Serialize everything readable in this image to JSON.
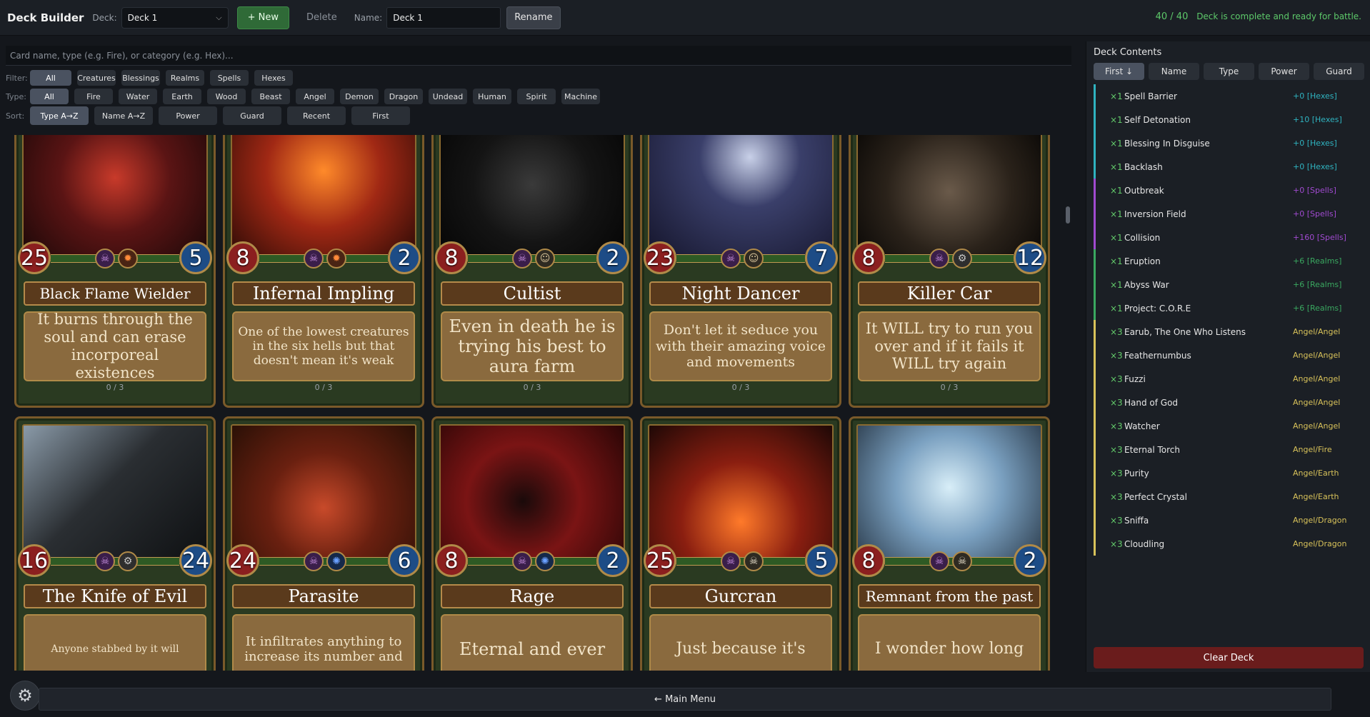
{
  "header": {
    "title": "Deck Builder",
    "deck_label": "Deck:",
    "deck_value": "Deck 1",
    "new_label": "+ New",
    "delete_label": "Delete",
    "name_label": "Name:",
    "name_value": "Deck 1",
    "rename_label": "Rename",
    "count": "40 / 40",
    "status": "Deck is complete and ready for battle."
  },
  "search": {
    "placeholder": "Card name, type (e.g. Fire), or category (e.g. Hex)..."
  },
  "filters": {
    "filter_label": "Filter:",
    "filter": [
      "All",
      "Creatures",
      "Blessings",
      "Realms",
      "Spells",
      "Hexes"
    ],
    "type_label": "Type:",
    "types": [
      "All",
      "Fire",
      "Water",
      "Earth",
      "Wood",
      "Beast",
      "Angel",
      "Demon",
      "Dragon",
      "Undead",
      "Human",
      "Spirit",
      "Machine"
    ],
    "sort_label": "Sort:",
    "sorts": [
      "Type A→Z",
      "Name A→Z",
      "Power",
      "Guard",
      "Recent",
      "First"
    ]
  },
  "cards": [
    {
      "name": "Black Flame Wielder",
      "power": "25",
      "guard": "5",
      "text": "It burns through the soul and can erase incorporeal existences",
      "owned": "0 / 3",
      "icons": [
        "demon-icon",
        "fire-icon"
      ]
    },
    {
      "name": "Infernal Impling",
      "power": "8",
      "guard": "2",
      "text": "One of the lowest creatures in the six hells but that doesn't mean it's weak",
      "owned": "0 / 3",
      "icons": [
        "demon-icon",
        "fire-icon"
      ]
    },
    {
      "name": "Cultist",
      "power": "8",
      "guard": "2",
      "text": "Even in death he is trying his best to aura farm",
      "owned": "0 / 3",
      "icons": [
        "demon-icon",
        "human-icon"
      ]
    },
    {
      "name": "Night Dancer",
      "power": "23",
      "guard": "7",
      "text": "Don't let it seduce you with their amazing voice and movements",
      "owned": "0 / 3",
      "icons": [
        "demon-icon",
        "human-icon"
      ]
    },
    {
      "name": "Killer Car",
      "power": "8",
      "guard": "12",
      "text": "It WILL try to run you over and if it fails it WILL try again",
      "owned": "0 / 3",
      "icons": [
        "demon-icon",
        "machine-icon"
      ]
    },
    {
      "name": "The Knife of Evil",
      "power": "16",
      "guard": "24",
      "text": "Anyone stabbed by it will",
      "owned": "",
      "icons": [
        "demon-icon",
        "machine-icon"
      ]
    },
    {
      "name": "Parasite",
      "power": "24",
      "guard": "6",
      "text": "It infiltrates anything to increase its number and",
      "owned": "",
      "icons": [
        "demon-icon",
        "spirit-icon"
      ]
    },
    {
      "name": "Rage",
      "power": "8",
      "guard": "2",
      "text": "Eternal and ever",
      "owned": "",
      "icons": [
        "demon-icon",
        "spirit-icon"
      ]
    },
    {
      "name": "Gurcran",
      "power": "25",
      "guard": "5",
      "text": "Just because it's",
      "owned": "",
      "icons": [
        "demon-icon",
        "undead-icon"
      ]
    },
    {
      "name": "Remnant from the past",
      "power": "8",
      "guard": "2",
      "text": "I wonder how long",
      "owned": "",
      "icons": [
        "demon-icon",
        "undead-icon"
      ]
    }
  ],
  "deck": {
    "title": "Deck Contents",
    "sort_tabs": [
      "First ↓",
      "Name",
      "Type",
      "Power",
      "Guard"
    ],
    "items": [
      {
        "qty": "×1",
        "name": "Spell Barrier",
        "meta": "+0 [Hexes]",
        "color": "#2fb3c0"
      },
      {
        "qty": "×1",
        "name": "Self Detonation",
        "meta": "+10 [Hexes]",
        "color": "#2fb3c0"
      },
      {
        "qty": "×1",
        "name": "Blessing In Disguise",
        "meta": "+0 [Hexes]",
        "color": "#2fb3c0"
      },
      {
        "qty": "×1",
        "name": "Backlash",
        "meta": "+0 [Hexes]",
        "color": "#2fb3c0"
      },
      {
        "qty": "×1",
        "name": "Outbreak",
        "meta": "+0 [Spells]",
        "color": "#a04ad0"
      },
      {
        "qty": "×1",
        "name": "Inversion Field",
        "meta": "+0 [Spells]",
        "color": "#a04ad0"
      },
      {
        "qty": "×1",
        "name": "Collision",
        "meta": "+160 [Spells]",
        "color": "#a04ad0"
      },
      {
        "qty": "×1",
        "name": "Eruption",
        "meta": "+6 [Realms]",
        "color": "#3aa860"
      },
      {
        "qty": "×1",
        "name": "Abyss War",
        "meta": "+6 [Realms]",
        "color": "#3aa860"
      },
      {
        "qty": "×1",
        "name": "Project: C.O.R.E",
        "meta": "+6 [Realms]",
        "color": "#3aa860"
      },
      {
        "qty": "×3",
        "name": "Earub, The One Who Listens",
        "meta": "Angel/Angel",
        "color": "#d8c25a"
      },
      {
        "qty": "×3",
        "name": "Feathernumbus",
        "meta": "Angel/Angel",
        "color": "#d8c25a"
      },
      {
        "qty": "×3",
        "name": "Fuzzi",
        "meta": "Angel/Angel",
        "color": "#d8c25a"
      },
      {
        "qty": "×3",
        "name": "Hand of God",
        "meta": "Angel/Angel",
        "color": "#d8c25a"
      },
      {
        "qty": "×3",
        "name": "Watcher",
        "meta": "Angel/Angel",
        "color": "#d8c25a"
      },
      {
        "qty": "×3",
        "name": "Eternal Torch",
        "meta": "Angel/Fire",
        "color": "#d8c25a"
      },
      {
        "qty": "×3",
        "name": "Purity",
        "meta": "Angel/Earth",
        "color": "#d8c25a"
      },
      {
        "qty": "×3",
        "name": "Perfect Crystal",
        "meta": "Angel/Earth",
        "color": "#d8c25a"
      },
      {
        "qty": "×3",
        "name": "Sniffa",
        "meta": "Angel/Dragon",
        "color": "#d8c25a"
      },
      {
        "qty": "×3",
        "name": "Cloudling",
        "meta": "Angel/Dragon",
        "color": "#d8c25a"
      }
    ],
    "clear_label": "Clear Deck"
  },
  "footer": {
    "main_menu_label": "← Main Menu",
    "settings_icon": "gear-icon"
  }
}
